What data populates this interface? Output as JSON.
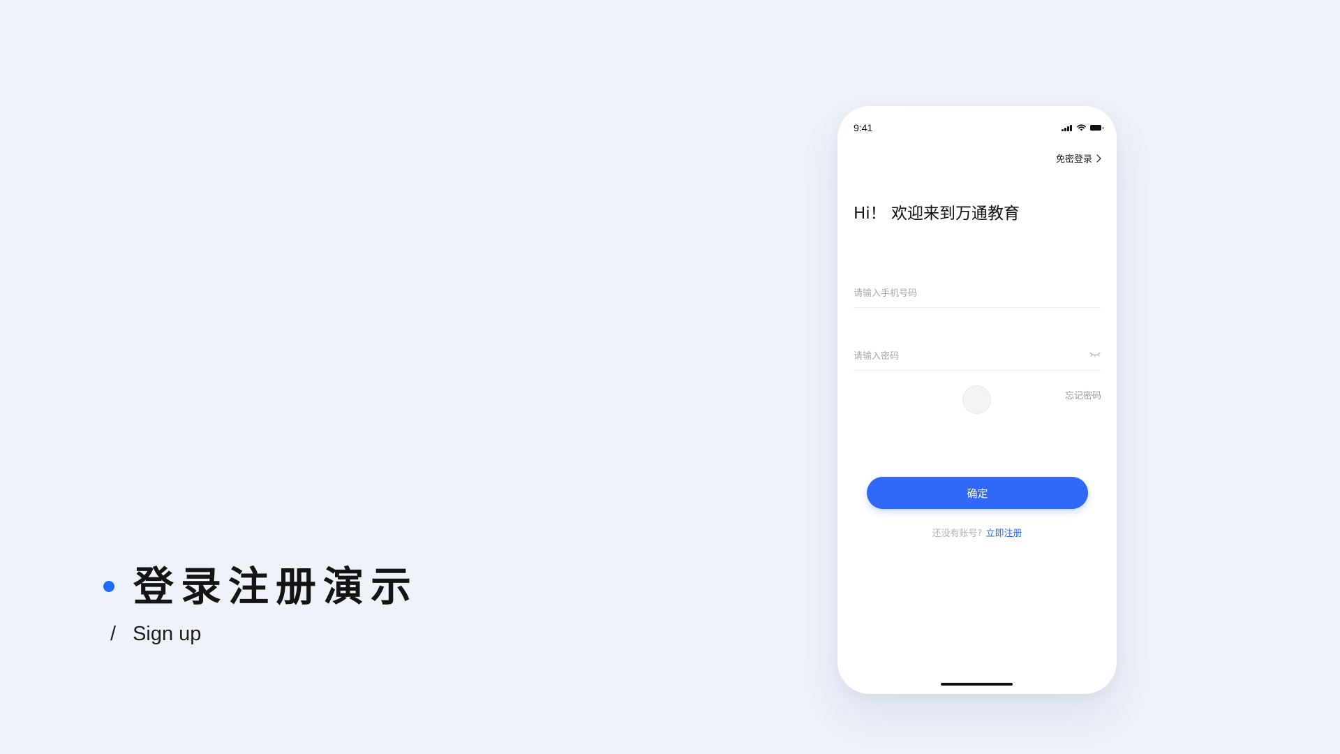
{
  "slide": {
    "title": "登录注册演示",
    "subtitle_slash": "/",
    "subtitle": "Sign up",
    "accent_color": "#1e6bff"
  },
  "phone": {
    "status_bar": {
      "time": "9:41",
      "icons": [
        "signal-icon",
        "wifi-icon",
        "battery-icon"
      ]
    },
    "quick_login_label": "免密登录",
    "greeting": "Hi！ 欢迎来到万通教育",
    "phone_field": {
      "placeholder": "请输入手机号码"
    },
    "password_field": {
      "placeholder": "请输入密码",
      "toggle_icon": "eye-closed-icon"
    },
    "forgot_password_label": "忘记密码",
    "confirm_label": "确定",
    "register_prompt": "还没有账号?",
    "register_link": "立即注册",
    "primary_color": "#2f69f6"
  }
}
